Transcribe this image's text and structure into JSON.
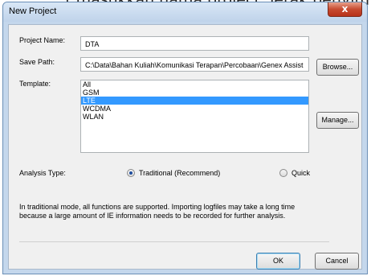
{
  "background": {
    "partial_text": "t masukkan nama project, letak penyim"
  },
  "window": {
    "title": "New Project",
    "close_glyph": "x"
  },
  "form": {
    "project_name_label": "Project Name:",
    "project_name_value": "DTA",
    "save_path_label": "Save Path:",
    "save_path_value": "C:\\Data\\Bahan Kuliah\\Komunikasi Terapan\\Percobaan\\Genex Assist",
    "browse_label": "Browse...",
    "template_label": "Template:",
    "manage_label": "Manage...",
    "templates": [
      {
        "label": "All",
        "selected": false
      },
      {
        "label": "GSM",
        "selected": false
      },
      {
        "label": "LTE",
        "selected": true
      },
      {
        "label": "WCDMA",
        "selected": false
      },
      {
        "label": "WLAN",
        "selected": false
      }
    ],
    "analysis_type_label": "Analysis Type:",
    "radio_traditional_label": "Traditional (Recommend)",
    "radio_traditional_checked": true,
    "radio_quick_label": "Quick",
    "radio_quick_checked": false,
    "description": "In traditional mode, all functions are supported. Importing logfiles may take a long time because a large amount of IE information needs to be recorded for further analysis."
  },
  "buttons": {
    "ok": "OK",
    "cancel": "Cancel"
  }
}
